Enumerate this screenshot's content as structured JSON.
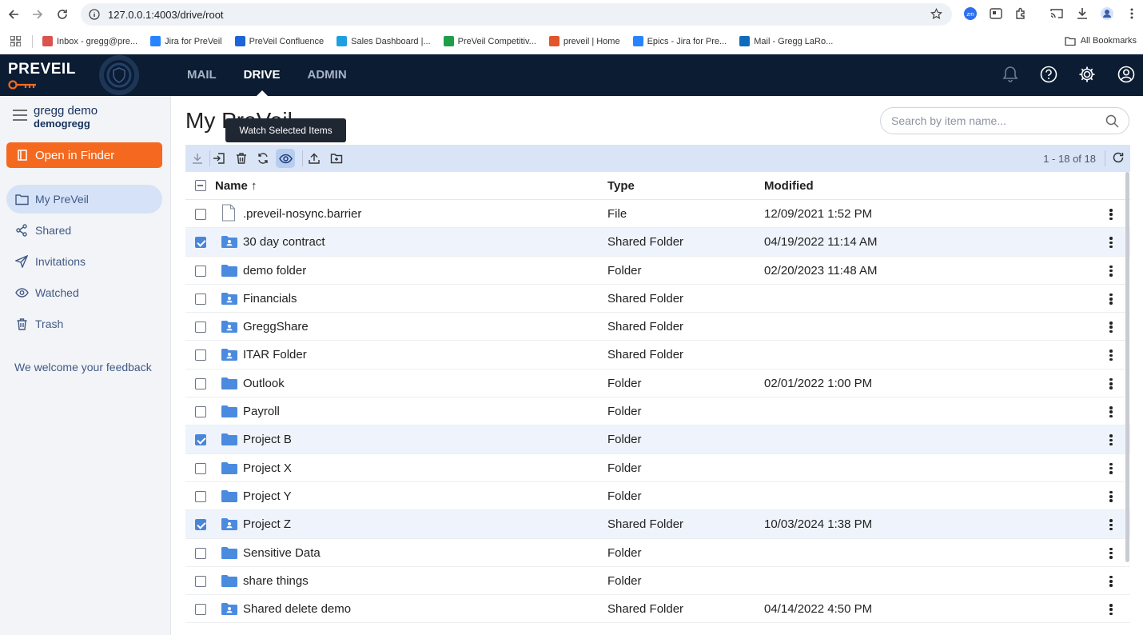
{
  "browser": {
    "url": "127.0.0.1:4003/drive/root",
    "bookmarks": [
      {
        "label": "Inbox - gregg@pre...",
        "color": "#d9534f"
      },
      {
        "label": "Jira for PreVeil",
        "color": "#2684ff"
      },
      {
        "label": "PreVeil Confluence",
        "color": "#1d64d8"
      },
      {
        "label": "Sales Dashboard |...",
        "color": "#1ea0e0"
      },
      {
        "label": "PreVeil Competitiv...",
        "color": "#1e9e4a"
      },
      {
        "label": "preveil | Home",
        "color": "#e0552b"
      },
      {
        "label": "Epics - Jira for Pre...",
        "color": "#2684ff"
      },
      {
        "label": "Mail - Gregg LaRo...",
        "color": "#0f6cbd"
      }
    ],
    "all_bookmarks": "All Bookmarks"
  },
  "app": {
    "logo": "PREVEIL",
    "nav": [
      {
        "label": "MAIL",
        "active": false
      },
      {
        "label": "DRIVE",
        "active": true
      },
      {
        "label": "ADMIN",
        "active": false
      }
    ]
  },
  "sidebar": {
    "user_name": "gregg demo",
    "user_id": "demogregg",
    "open_finder": "Open in Finder",
    "items": [
      {
        "label": "My PreVeil",
        "icon": "folder-icon",
        "active": true
      },
      {
        "label": "Shared",
        "icon": "share-icon",
        "active": false
      },
      {
        "label": "Invitations",
        "icon": "send-icon",
        "active": false
      },
      {
        "label": "Watched",
        "icon": "eye-icon",
        "active": false
      },
      {
        "label": "Trash",
        "icon": "trash-icon",
        "active": false
      }
    ],
    "feedback": "We welcome your feedback"
  },
  "main": {
    "title": "My PreVeil",
    "search_placeholder": "Search by item name...",
    "tooltip": "Watch Selected Items",
    "count": "1 - 18 of 18",
    "columns": {
      "name": "Name ↑",
      "type": "Type",
      "modified": "Modified"
    },
    "rows": [
      {
        "name": ".preveil-nosync.barrier",
        "type": "File",
        "modified": "12/09/2021 1:52 PM",
        "kind": "file",
        "checked": false
      },
      {
        "name": "30 day contract",
        "type": "Shared Folder",
        "modified": "04/19/2022 11:14 AM",
        "kind": "shared",
        "checked": true
      },
      {
        "name": "demo folder",
        "type": "Folder",
        "modified": "02/20/2023 11:48 AM",
        "kind": "folder",
        "checked": false
      },
      {
        "name": "Financials",
        "type": "Shared Folder",
        "modified": "",
        "kind": "shared",
        "checked": false
      },
      {
        "name": "GreggShare",
        "type": "Shared Folder",
        "modified": "",
        "kind": "shared",
        "checked": false
      },
      {
        "name": "ITAR Folder",
        "type": "Shared Folder",
        "modified": "",
        "kind": "shared",
        "checked": false
      },
      {
        "name": "Outlook",
        "type": "Folder",
        "modified": "02/01/2022 1:00 PM",
        "kind": "folder",
        "checked": false
      },
      {
        "name": "Payroll",
        "type": "Folder",
        "modified": "",
        "kind": "folder",
        "checked": false
      },
      {
        "name": "Project B",
        "type": "Folder",
        "modified": "",
        "kind": "folder",
        "checked": true
      },
      {
        "name": "Project X",
        "type": "Folder",
        "modified": "",
        "kind": "folder",
        "checked": false
      },
      {
        "name": "Project Y",
        "type": "Folder",
        "modified": "",
        "kind": "folder",
        "checked": false
      },
      {
        "name": "Project Z",
        "type": "Shared Folder",
        "modified": "10/03/2024 1:38 PM",
        "kind": "shared",
        "checked": true
      },
      {
        "name": "Sensitive Data",
        "type": "Folder",
        "modified": "",
        "kind": "folder",
        "checked": false
      },
      {
        "name": "share things",
        "type": "Folder",
        "modified": "",
        "kind": "folder",
        "checked": false
      },
      {
        "name": "Shared delete demo",
        "type": "Shared Folder",
        "modified": "04/14/2022 4:50 PM",
        "kind": "shared",
        "checked": false
      }
    ]
  }
}
